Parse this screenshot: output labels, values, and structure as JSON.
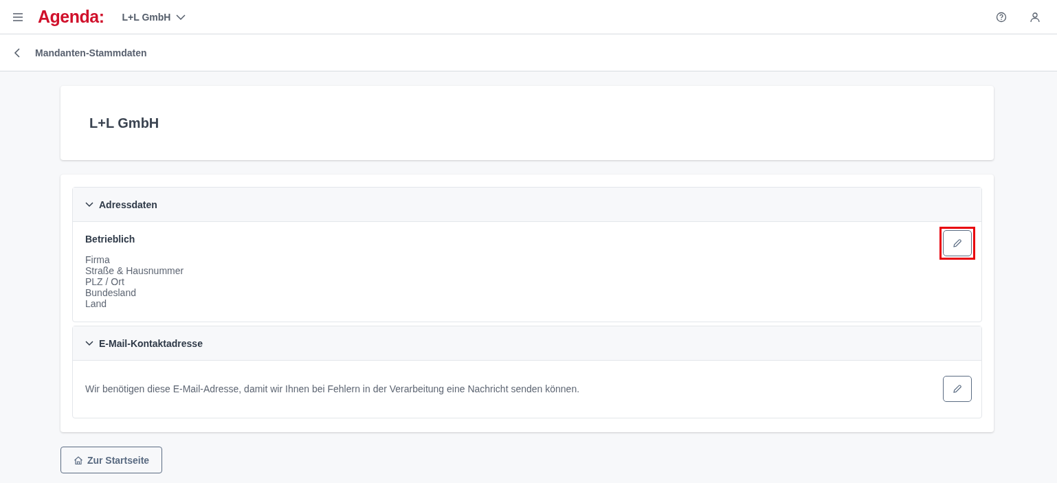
{
  "header": {
    "logo": "Agenda:",
    "client": "L+L GmbH"
  },
  "subheader": {
    "title": "Mandanten-Stammdaten"
  },
  "client_card": {
    "title": "L+L GmbH"
  },
  "sections": [
    {
      "title": "Adressdaten",
      "expanded": true,
      "kind": "address",
      "heading": "Betrieblich",
      "lines": [
        "Firma",
        "Straße & Hausnummer",
        "PLZ / Ort",
        "Bundesland",
        "Land"
      ],
      "edit_highlighted": true
    },
    {
      "title": "E-Mail-Kontaktadresse",
      "expanded": true,
      "kind": "text",
      "text": "Wir benötigen diese E-Mail-Adresse, damit wir Ihnen bei Fehlern in der Verarbeitung eine Nachricht senden können.",
      "edit_highlighted": false
    }
  ],
  "home_button": "Zur Startseite"
}
